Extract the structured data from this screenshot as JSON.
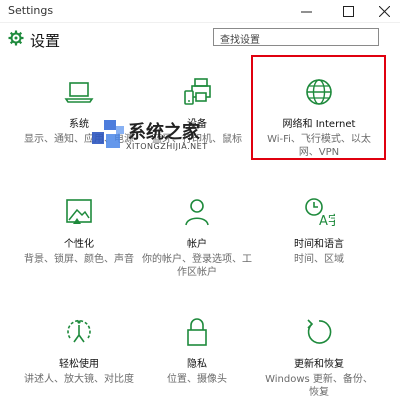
{
  "window": {
    "title": "Settings",
    "min_icon": "minimize-icon",
    "max_icon": "maximize-icon",
    "close_icon": "close-icon"
  },
  "header": {
    "title": "设置",
    "search_placeholder": "查找设置"
  },
  "accent": "#1e8a3c",
  "watermark": {
    "text": "系统之家",
    "sub": "XITONGZHIJIA.NET"
  },
  "tiles": [
    {
      "name": "系统",
      "desc": "显示、通知、应用、电源",
      "icon": "laptop-icon"
    },
    {
      "name": "设备",
      "desc": "蓝牙、打印机、鼠标",
      "icon": "devices-icon"
    },
    {
      "name": "网络和 Internet",
      "desc": "Wi-Fi、飞行模式、以太网、VPN",
      "icon": "globe-icon"
    },
    {
      "name": "个性化",
      "desc": "背景、锁屏、颜色、声音",
      "icon": "personalization-icon"
    },
    {
      "name": "帐户",
      "desc": "你的帐户、登录选项、工作区帐户",
      "icon": "person-icon"
    },
    {
      "name": "时间和语言",
      "desc": "时间、区域",
      "icon": "time-language-icon"
    },
    {
      "name": "轻松使用",
      "desc": "讲述人、放大镜、对比度",
      "icon": "ease-of-access-icon"
    },
    {
      "name": "隐私",
      "desc": "位置、摄像头",
      "icon": "lock-icon"
    },
    {
      "name": "更新和恢复",
      "desc": "Windows 更新、备份、恢复",
      "icon": "update-icon"
    }
  ]
}
